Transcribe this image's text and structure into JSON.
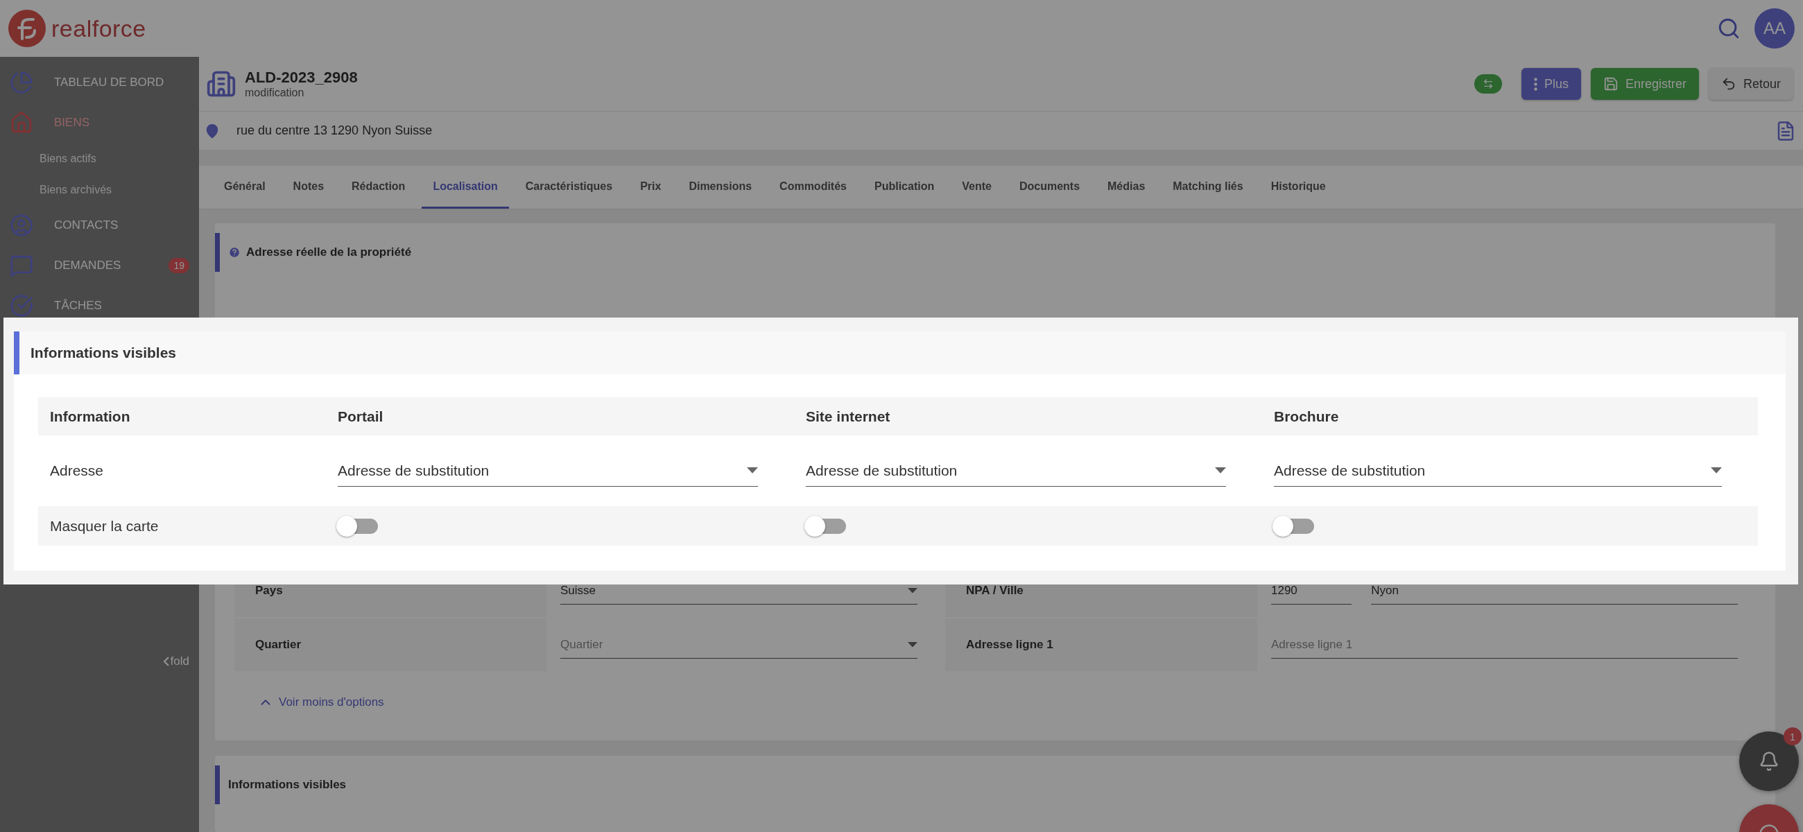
{
  "topbar": {
    "logo": "realforce",
    "avatar": "AA"
  },
  "sidebar": {
    "items": [
      {
        "kind": "dashboard",
        "label": "TABLEAU DE BORD",
        "selected": false
      },
      {
        "kind": "home",
        "label": "BIENS",
        "selected": true,
        "children": [
          {
            "label": "Biens actifs"
          },
          {
            "label": "Biens archivés"
          }
        ]
      },
      {
        "kind": "contact",
        "label": "CONTACTS",
        "selected": false
      },
      {
        "kind": "chat",
        "label": "DEMANDES",
        "selected": false,
        "badge": "19"
      },
      {
        "kind": "check",
        "label": "TÂCHES",
        "selected": false
      }
    ],
    "fold": "fold"
  },
  "record": {
    "title": "ALD-2023_2908",
    "subtitle": "modification",
    "address": "rue du centre 13 1290 Nyon Suisse"
  },
  "actions": [
    {
      "kind": "swap"
    },
    {
      "kind": "more",
      "label": "Plus"
    },
    {
      "kind": "save",
      "label": "Enregistrer"
    },
    {
      "kind": "back",
      "label": "Retour"
    }
  ],
  "tabs": [
    {
      "label": "Général",
      "selected": false
    },
    {
      "label": "Notes",
      "selected": false
    },
    {
      "label": "Rédaction",
      "selected": false
    },
    {
      "label": "Localisation",
      "selected": true
    },
    {
      "label": "Caractéristiques",
      "selected": false
    },
    {
      "label": "Prix",
      "selected": false
    },
    {
      "label": "Dimensions",
      "selected": false
    },
    {
      "label": "Commodités",
      "selected": false
    },
    {
      "label": "Publication",
      "selected": false
    },
    {
      "label": "Vente",
      "selected": false
    },
    {
      "label": "Documents",
      "selected": false
    },
    {
      "label": "Médias",
      "selected": false
    },
    {
      "label": "Matching liés",
      "selected": false
    },
    {
      "label": "Historique",
      "selected": false
    }
  ],
  "section": {
    "title": "Adresse réelle de la propriété",
    "fields": [
      {
        "label": "Pays",
        "kind": "select",
        "value": "Suisse"
      },
      {
        "label": "NPA / Ville",
        "kind": "pair",
        "values": [
          "1290",
          "Nyon"
        ]
      },
      {
        "label": "Quartier",
        "kind": "select",
        "placeholder": "Quartier"
      },
      {
        "label": "Adresse ligne 1",
        "kind": "text",
        "placeholder": "Adresse ligne 1"
      }
    ],
    "toggle_link": "Voir moins d'options"
  },
  "next_section": {
    "title": "Informations visibles"
  },
  "notifications": {
    "badge": "1"
  },
  "highlight": {
    "title": "Informations visibles",
    "columns": [
      "Information",
      "Portail",
      "Site internet",
      "Brochure"
    ],
    "rows": [
      {
        "kind": "select",
        "cells": [
          {
            "label": "Adresse"
          },
          {
            "value": "Adresse de substitution"
          },
          {
            "value": "Adresse de substitution"
          },
          {
            "value": "Adresse de substitution"
          }
        ]
      },
      {
        "kind": "toggle",
        "cells": [
          {
            "label": "Masquer la carte"
          },
          {
            "on": false
          },
          {
            "on": false
          },
          {
            "on": false
          }
        ]
      }
    ]
  }
}
